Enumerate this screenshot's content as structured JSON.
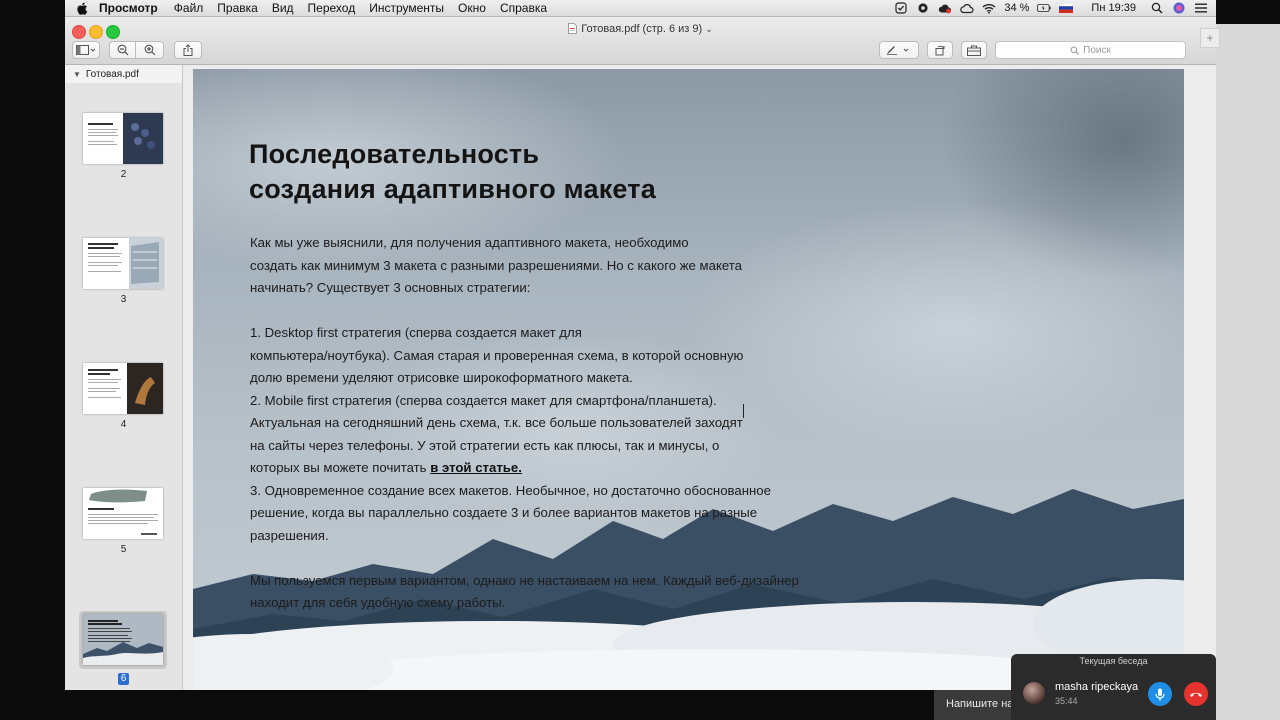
{
  "menubar": {
    "app": "Просмотр",
    "items": [
      "Файл",
      "Правка",
      "Вид",
      "Переход",
      "Инструменты",
      "Окно",
      "Справка"
    ],
    "battery": "34 %",
    "clock": "Пн 19:39"
  },
  "window": {
    "title": "Готовая.pdf (стр. 6 из 9)",
    "search_placeholder": "Поиск"
  },
  "sidebar": {
    "file_name": "Готовая.pdf",
    "pages": [
      "2",
      "3",
      "4",
      "5",
      "6"
    ],
    "selected_page": "6"
  },
  "slide": {
    "title_lines": [
      "Последовательность",
      "создания адаптивного макета"
    ],
    "p1": [
      "Как мы уже выяснили, для получения адаптивного макета, необходимо",
      "создать как минимум 3 макета с разными разрешениями. Но с какого же макета",
      "начинать? Существует 3 основных стратегии:"
    ],
    "p2": [
      "1. Desktop first стратегия (сперва создается макет для",
      "компьютера/ноутбука). Самая старая и проверенная схема, в которой основную",
      "долю времени уделяют отрисовке широкоформатного макета.",
      "2. Mobile first стратегия (сперва создается макет для смартфона/планшета).",
      "Актуальная на сегодняшний день схема, т.к. все больше пользователей заходят",
      "на сайты через телефоны. У этой стратегии есть как плюсы, так и минусы, о"
    ],
    "p2_last_prefix": "которых вы можете почитать ",
    "p2_link": "в этой статье.",
    "p3": [
      "3. Одновременное создание всех макетов. Необычное, но достаточно обоснованное",
      "решение, когда вы параллельно создаете 3 и более вариантов макетов на разные",
      "разрешения."
    ],
    "p4": [
      "Мы пользуемся первым вариантом, однако не настаиваем на нем. Каждый веб-дизайнер",
      "находит для себя удобную схему работы."
    ]
  },
  "call_widget": {
    "header": "Текущая беседа",
    "caller": "masha ripeckaya",
    "duration": "35:44"
  },
  "chat_input": {
    "placeholder": "Напишите на"
  }
}
